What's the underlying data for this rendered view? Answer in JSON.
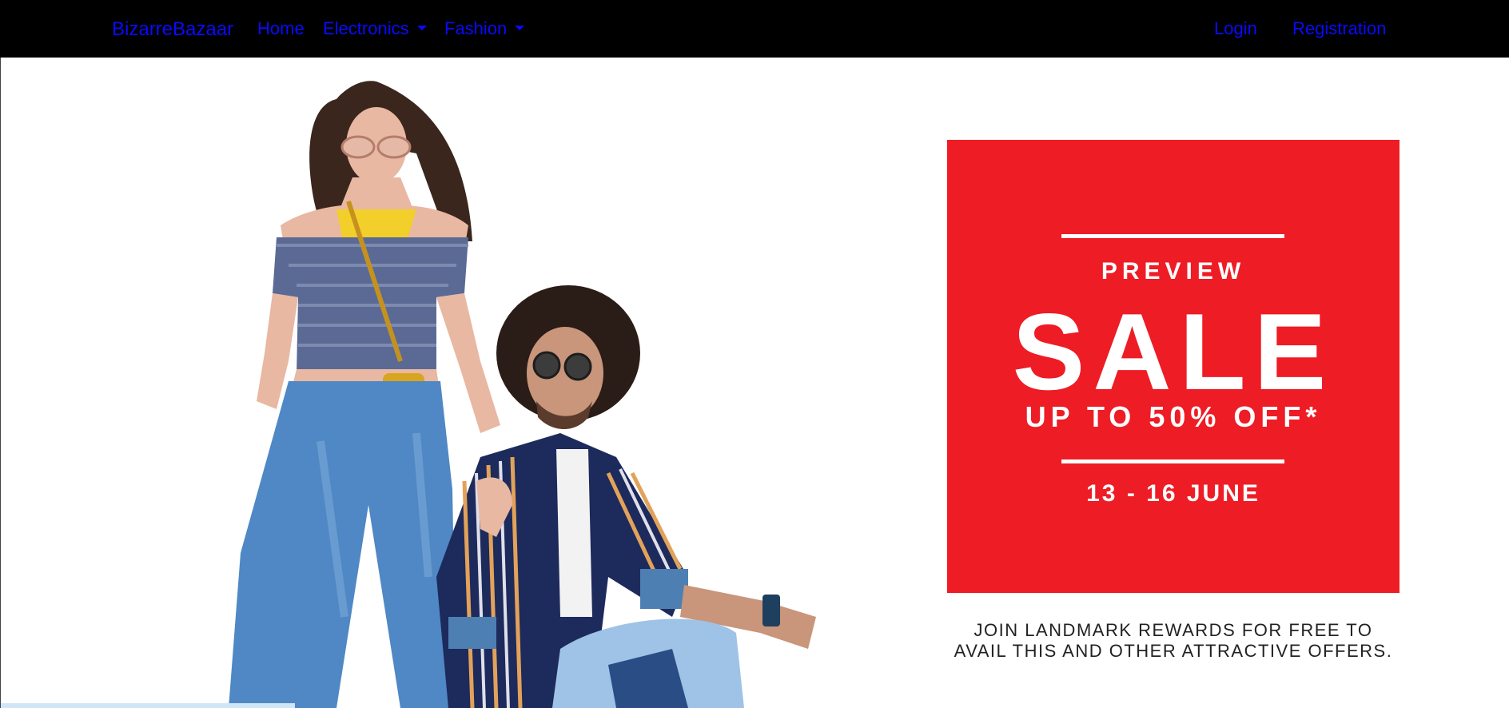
{
  "navbar": {
    "brand": "BizarreBazaar",
    "home": "Home",
    "electronics": "Electronics",
    "fashion": "Fashion",
    "login": "Login",
    "registration": "Registration"
  },
  "banner": {
    "preview": "PREVIEW",
    "sale": "SALE",
    "discount": "UP TO 50% OFF*",
    "dates": "13 - 16 JUNE",
    "rewards_line1": "JOIN LANDMARK REWARDS FOR FREE TO",
    "rewards_line2": "AVAIL THIS AND OTHER ATTRACTIVE OFFERS."
  },
  "carousel": {
    "next_icon": "›"
  },
  "colors": {
    "navbar_bg": "#000000",
    "link": "#0a0aff",
    "sale_red": "#ee1c25"
  }
}
